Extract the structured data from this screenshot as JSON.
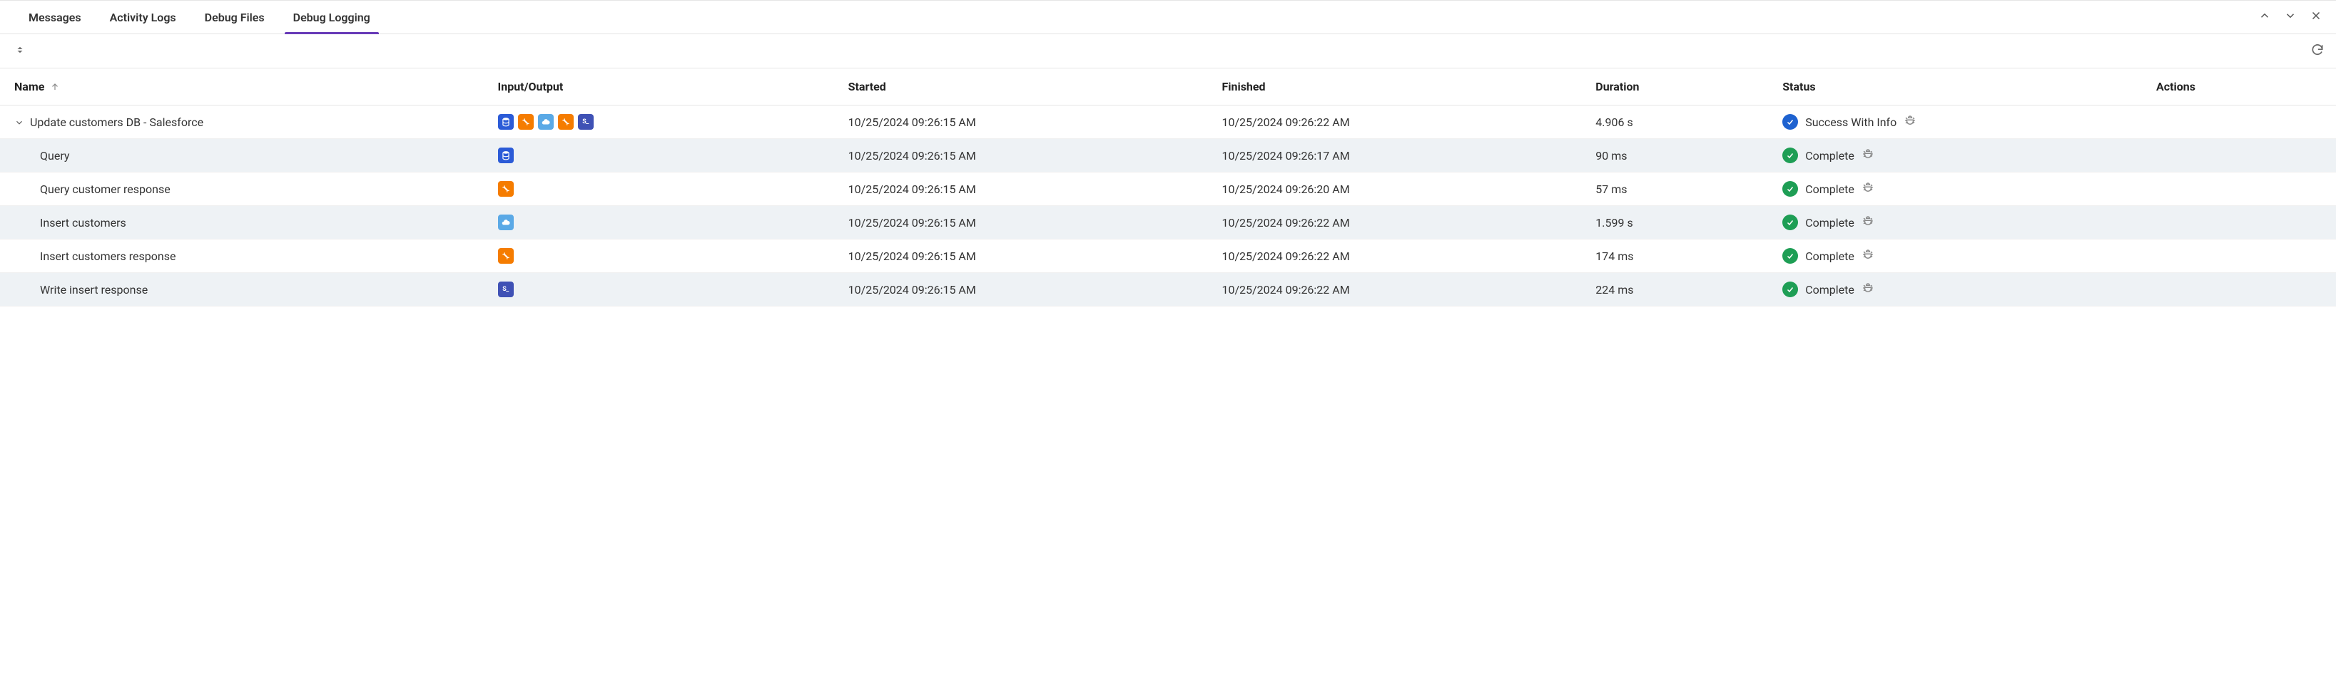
{
  "tabs": {
    "items": [
      {
        "label": "Messages"
      },
      {
        "label": "Activity Logs"
      },
      {
        "label": "Debug Files"
      },
      {
        "label": "Debug Logging"
      }
    ],
    "active_index": 3
  },
  "table": {
    "columns": {
      "name": "Name",
      "io": "Input/Output",
      "started": "Started",
      "finished": "Finished",
      "duration": "Duration",
      "status": "Status",
      "actions": "Actions"
    },
    "rows": [
      {
        "name": "Update customers DB - Salesforce",
        "depth": 0,
        "expandable": true,
        "expanded": true,
        "io_icons": [
          "db",
          "transform",
          "cloud",
          "transform",
          "script"
        ],
        "started": "10/25/2024 09:26:15 AM",
        "finished": "10/25/2024 09:26:22 AM",
        "duration": "4.906 s",
        "status_kind": "info",
        "status_text": "Success With Info"
      },
      {
        "name": "Query",
        "depth": 1,
        "expandable": false,
        "io_icons": [
          "db"
        ],
        "started": "10/25/2024 09:26:15 AM",
        "finished": "10/25/2024 09:26:17 AM",
        "duration": "90 ms",
        "status_kind": "ok",
        "status_text": "Complete"
      },
      {
        "name": "Query customer response",
        "depth": 1,
        "expandable": false,
        "io_icons": [
          "transform"
        ],
        "started": "10/25/2024 09:26:15 AM",
        "finished": "10/25/2024 09:26:20 AM",
        "duration": "57 ms",
        "status_kind": "ok",
        "status_text": "Complete"
      },
      {
        "name": "Insert customers",
        "depth": 1,
        "expandable": false,
        "io_icons": [
          "cloud"
        ],
        "started": "10/25/2024 09:26:15 AM",
        "finished": "10/25/2024 09:26:22 AM",
        "duration": "1.599 s",
        "status_kind": "ok",
        "status_text": "Complete"
      },
      {
        "name": "Insert customers response",
        "depth": 1,
        "expandable": false,
        "io_icons": [
          "transform"
        ],
        "started": "10/25/2024 09:26:15 AM",
        "finished": "10/25/2024 09:26:22 AM",
        "duration": "174 ms",
        "status_kind": "ok",
        "status_text": "Complete"
      },
      {
        "name": "Write insert response",
        "depth": 1,
        "expandable": false,
        "io_icons": [
          "script"
        ],
        "started": "10/25/2024 09:26:15 AM",
        "finished": "10/25/2024 09:26:22 AM",
        "duration": "224 ms",
        "status_kind": "ok",
        "status_text": "Complete"
      }
    ]
  }
}
